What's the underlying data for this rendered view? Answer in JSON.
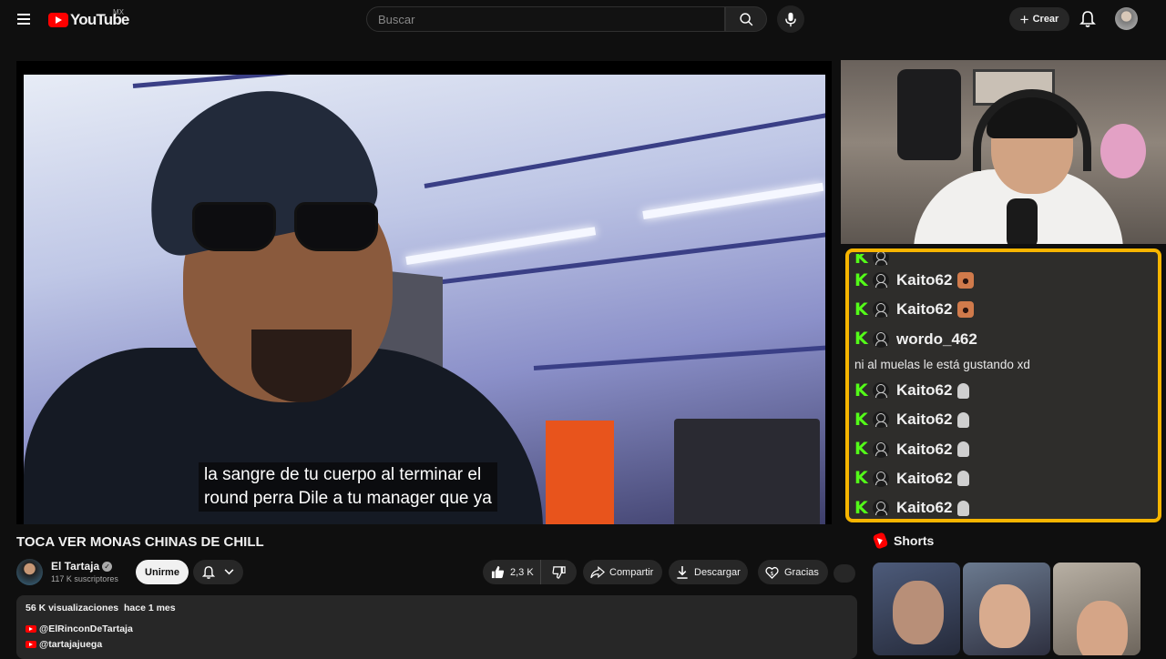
{
  "header": {
    "logo_text": "YouTube",
    "region": "MX",
    "search_placeholder": "Buscar",
    "create_label": "Crear"
  },
  "video": {
    "subtitle_line1": "la sangre de tu cuerpo al terminar el",
    "subtitle_line2": "round perra Dile a tu manager que ya",
    "title": "TOCA VER MONAS CHINAS DE CHILL"
  },
  "channel": {
    "name": "El Tartaja",
    "subscribers": "117 K suscriptores",
    "join_label": "Unirme"
  },
  "actions": {
    "likes": "2,3 K",
    "share_label": "Compartir",
    "download_label": "Descargar",
    "thanks_label": "Gracias"
  },
  "description": {
    "views": "56 K visualizaciones",
    "age": "hace 1 mes",
    "link1": "@ElRinconDeTartaja",
    "link2": "@tartajajuega"
  },
  "chat": {
    "messages": [
      {
        "user": "Kaito62",
        "emote": "face"
      },
      {
        "user": "Kaito62",
        "emote": "face"
      },
      {
        "user": "wordo_462",
        "text": "ni al muelas le está gustando xd"
      },
      {
        "user": "Kaito62",
        "emote": "ghost"
      },
      {
        "user": "Kaito62",
        "emote": "ghost"
      },
      {
        "user": "Kaito62",
        "emote": "ghost"
      },
      {
        "user": "Kaito62",
        "emote": "ghost"
      },
      {
        "user": "Kaito62",
        "emote": "ghost"
      }
    ]
  },
  "shorts": {
    "heading": "Shorts"
  },
  "colors": {
    "background": "#0f0f0f",
    "brand_red": "#ff0000",
    "chat_border": "#f7b500",
    "kick_green": "#53fc18"
  },
  "icons": [
    "menu-icon",
    "search-icon",
    "mic-icon",
    "plus-icon",
    "bell-icon",
    "verified-icon",
    "chevron-down-icon",
    "like-icon",
    "dislike-icon",
    "share-icon",
    "download-icon",
    "thanks-icon",
    "user-icon",
    "kick-icon",
    "shorts-icon"
  ]
}
